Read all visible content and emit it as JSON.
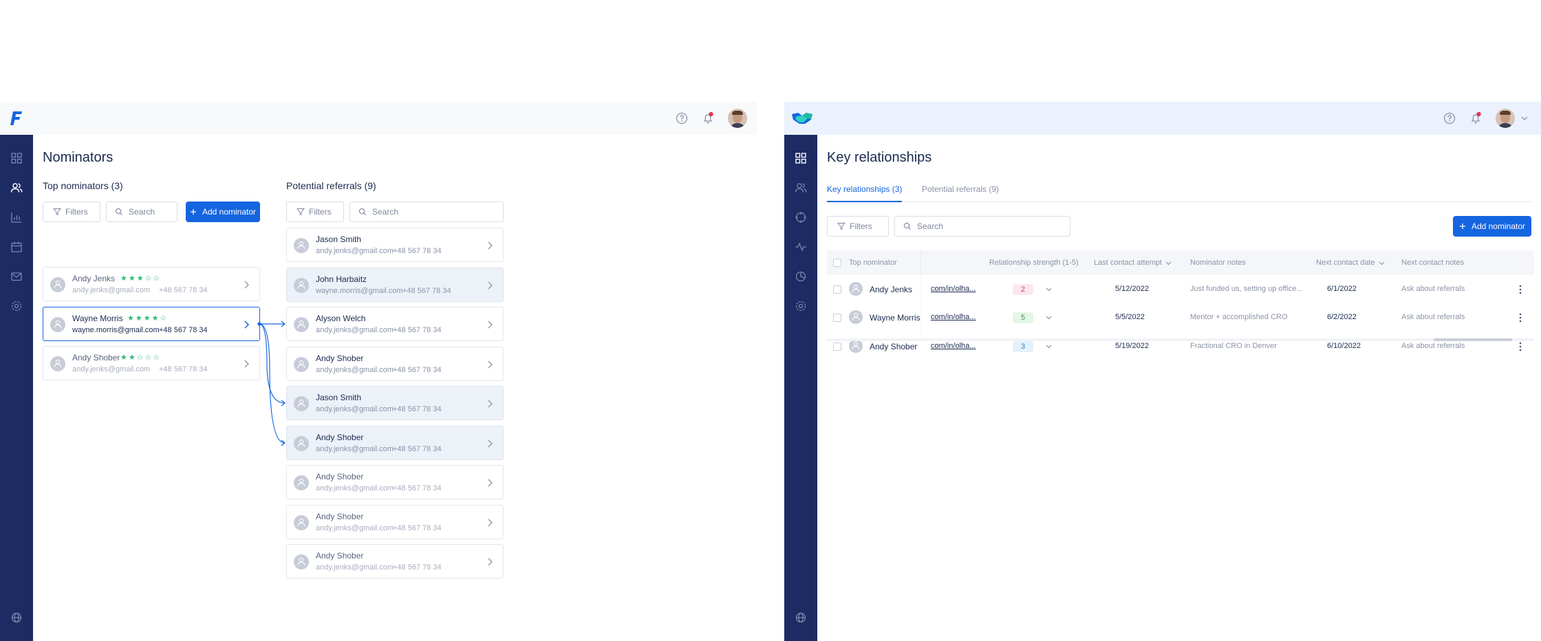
{
  "left_app": {
    "page_title": "Nominators",
    "top_nominators": {
      "title": "Top nominators (3)",
      "filters_label": "Filters",
      "search_placeholder": "Search",
      "add_label": "Add nominator",
      "items": [
        {
          "name": "Andy Jenks",
          "email": "andy.jenks@gmail.com",
          "phone": "+48 567 78 34",
          "rating": 3
        },
        {
          "name": "Wayne Morris",
          "email": "wayne.morris@gmail.com",
          "phone": "+48 567 78 34",
          "rating": 4
        },
        {
          "name": "Andy Shober",
          "email": "andy.jenks@gmail.com",
          "phone": "+48 567 78 34",
          "rating": 2
        }
      ]
    },
    "potential_referrals": {
      "title": "Potential referrals (9)",
      "filters_label": "Filters",
      "search_placeholder": "Search",
      "items": [
        {
          "name": "Jason Smith",
          "email": "andy.jenks@gmail.com",
          "phone": "+48 567 78 34"
        },
        {
          "name": "John Harbaitz",
          "email": "wayne.morris@gmail.com",
          "phone": "+48 567 78 34"
        },
        {
          "name": "Alyson Welch",
          "email": "andy.jenks@gmail.com",
          "phone": "+48 567 78 34"
        },
        {
          "name": "Andy Shober",
          "email": "andy.jenks@gmail.com",
          "phone": "+48 567 78 34"
        },
        {
          "name": "Jason Smith",
          "email": "andy.jenks@gmail.com",
          "phone": "+48 567 78 34"
        },
        {
          "name": "Andy Shober",
          "email": "andy.jenks@gmail.com",
          "phone": "+48 567 78 34"
        },
        {
          "name": "Andy Shober",
          "email": "andy.jenks@gmail.com",
          "phone": "+48 567 78 34"
        },
        {
          "name": "Andy Shober",
          "email": "andy.jenks@gmail.com",
          "phone": "+48 567 78 34"
        },
        {
          "name": "Andy Shober",
          "email": "andy.jenks@gmail.com",
          "phone": "+48 567 78 34"
        }
      ]
    }
  },
  "right_app": {
    "page_title": "Key relationships",
    "tabs": [
      {
        "label": "Key relationships (3)",
        "active": true
      },
      {
        "label": "Potential referrals (9)",
        "active": false
      }
    ],
    "filters_label": "Filters",
    "search_placeholder": "Search",
    "add_label": "Add nominator",
    "columns": [
      "Top nominator",
      "Relationship strength (1-5)",
      "Last contact attempt",
      "Nominator notes",
      "Next contact date",
      "Next contact notes"
    ],
    "rows": [
      {
        "name": "Andy Jenks",
        "link": "com/in/olha...",
        "strength": "2",
        "last_contact": "5/12/2022",
        "notes": "Just funded us, setting up office...",
        "next_date": "6/1/2022",
        "next_notes": "Ask about referrals"
      },
      {
        "name": "Wayne Morris",
        "link": "com/in/olha...",
        "strength": "5",
        "last_contact": "5/5/2022",
        "notes": "Mentor + accomplished CRO",
        "next_date": "6/2/2022",
        "next_notes": "Ask about referrals"
      },
      {
        "name": "Andy Shober",
        "link": "com/in/olha...",
        "strength": "3",
        "last_contact": "5/19/2022",
        "notes": "Fractional CRO in Denver",
        "next_date": "6/10/2022",
        "next_notes": "Ask about referrals"
      }
    ]
  },
  "colors": {
    "accent": "#1565e0",
    "sidebar": "#1c2b62",
    "star": "#2db87a",
    "notification": "#e8325a"
  },
  "icons": [
    "help-icon",
    "bell-icon",
    "dashboard-icon",
    "users-icon",
    "chart-icon",
    "calendar-icon",
    "mail-icon",
    "settings-icon",
    "globe-icon",
    "filter-icon",
    "search-icon",
    "plus-icon",
    "chevron-right-icon",
    "chevron-down-icon",
    "kebab-icon"
  ]
}
